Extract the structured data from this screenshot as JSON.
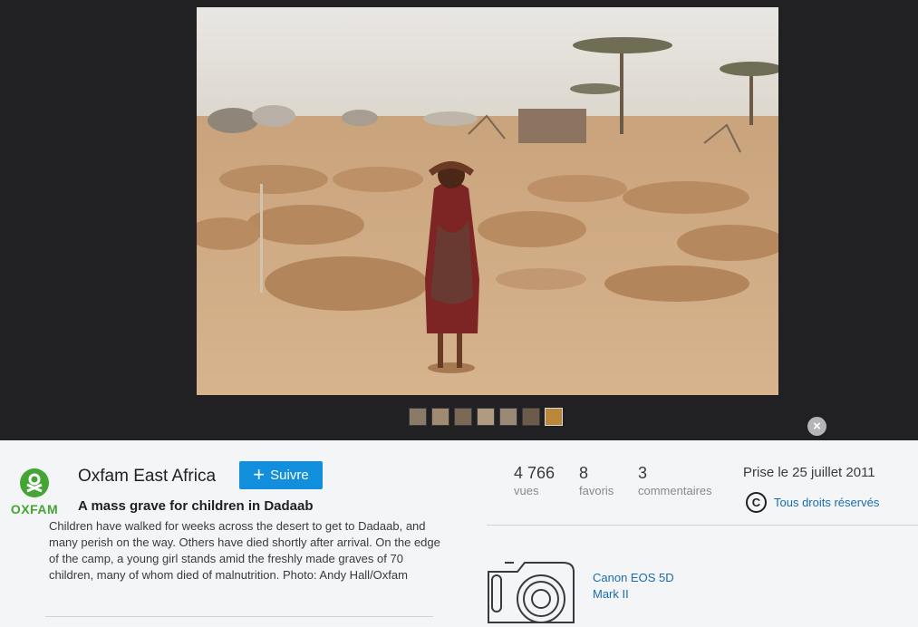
{
  "viewer": {
    "photo_icon": "photo",
    "thumbnails": [
      "thumb-1",
      "thumb-2",
      "thumb-3",
      "thumb-4",
      "thumb-5",
      "thumb-6",
      "thumb-7"
    ],
    "close_icon": "close-icon",
    "close_label": "×"
  },
  "owner": {
    "logo_text": "OXFAM",
    "name": "Oxfam East Africa",
    "follow_label": "Suivre",
    "follow_plus": "+"
  },
  "photo": {
    "title": "A mass grave for children in Dadaab",
    "description": "Children have walked for weeks across the desert to get to Dadaab, and many perish on the way. Others have died shortly after arrival. On the edge of the camp, a young girl stands amid the freshly made graves of 70 children, many of whom died of malnutrition. Photo: Andy Hall/Oxfam"
  },
  "stats": {
    "views_value": "4 766",
    "views_label": "vues",
    "faves_value": "8",
    "faves_label": "favoris",
    "comments_value": "3",
    "comments_label": "commentaires"
  },
  "meta": {
    "taken": "Prise le 25 juillet 2011",
    "license_icon": "C",
    "license": "Tous droits réservés",
    "camera_line1": "Canon EOS 5D",
    "camera_line2": "Mark II"
  },
  "colors": {
    "viewer_bg": "#212124",
    "follow_blue": "#128fdc",
    "link_blue": "#1a6cb0",
    "oxfam_green": "#44a434"
  }
}
